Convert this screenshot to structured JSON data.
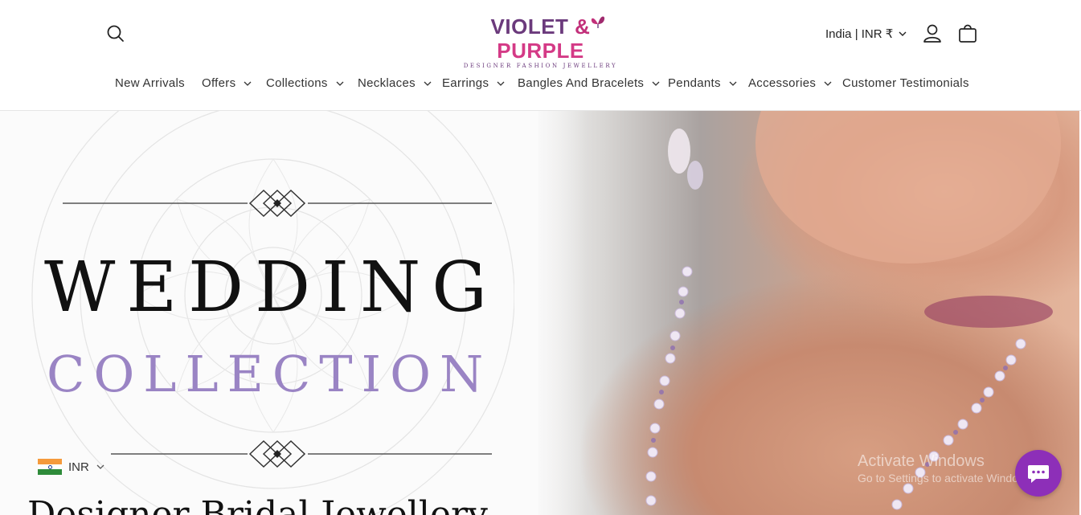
{
  "header": {
    "logo": {
      "brand": [
        "VIOLET ",
        "&",
        " PURPLE"
      ],
      "tagline": "Designer Fashion Jewellery"
    },
    "region_label": "India | INR ₹"
  },
  "nav": {
    "items": [
      {
        "label": "New Arrivals",
        "has_dropdown": false
      },
      {
        "label": "Offers",
        "has_dropdown": true
      },
      {
        "label": "Collections",
        "has_dropdown": true
      },
      {
        "label": "Necklaces",
        "has_dropdown": true
      },
      {
        "label": "Earrings",
        "has_dropdown": true
      },
      {
        "label": "Bangles And Bracelets",
        "has_dropdown": true
      },
      {
        "label": "Pendants",
        "has_dropdown": true
      },
      {
        "label": "Accessories",
        "has_dropdown": true
      },
      {
        "label": "Customer Testimonials",
        "has_dropdown": false
      }
    ]
  },
  "hero": {
    "title_line1": "WEDDING",
    "title_line2": "COLLECTION",
    "subtitle": "Designer Bridal Jewellery"
  },
  "currency_selector": {
    "code": "INR"
  },
  "os_watermark": {
    "title": "Activate Windows",
    "subtitle": "Go to Settings to activate Windows."
  },
  "colors": {
    "brand_purple": "#6b3a7c",
    "brand_pink": "#d43a86",
    "collection_lavender": "#9a84c4",
    "chat_button": "#8d2fb8"
  }
}
